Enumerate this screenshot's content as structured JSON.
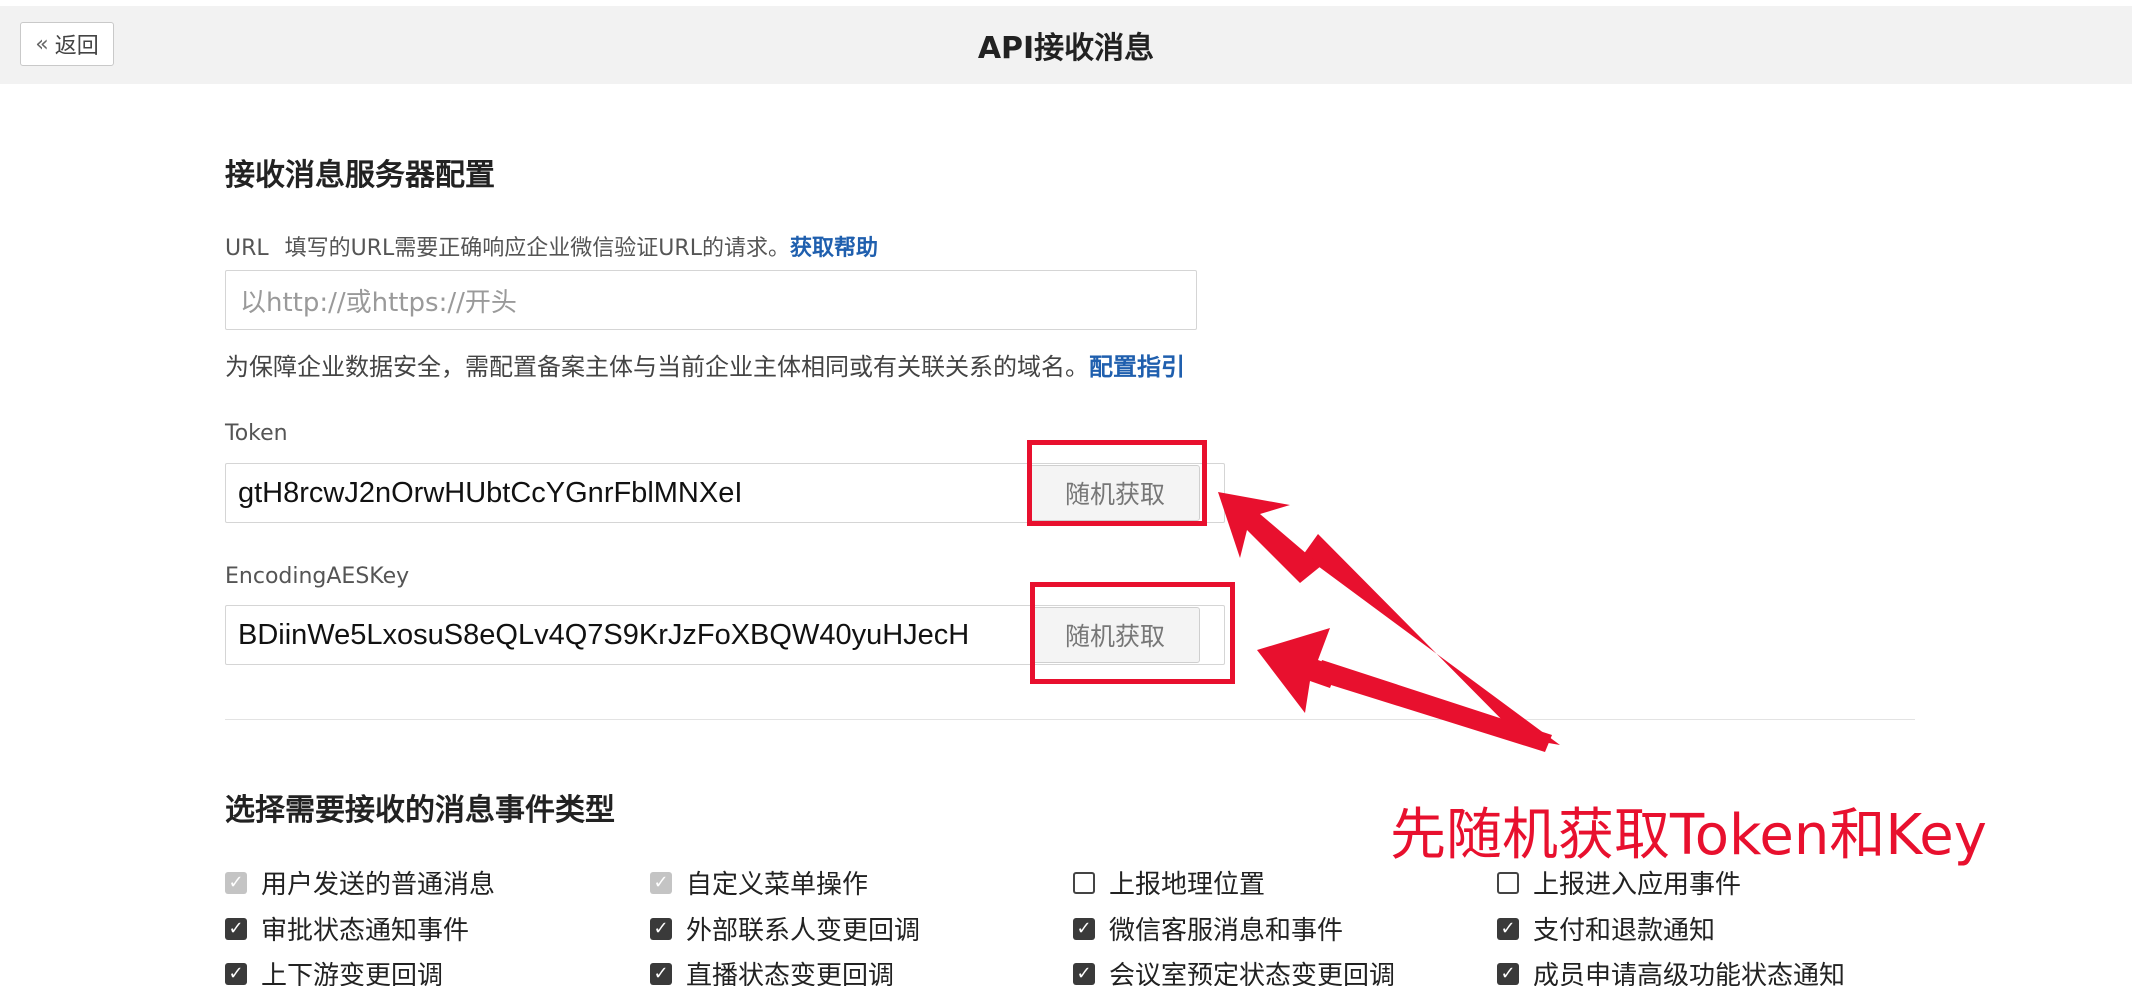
{
  "header": {
    "back_icon": "double-chevron-left-icon",
    "back_label": "返回",
    "title": "API接收消息"
  },
  "server_config": {
    "section_title": "接收消息服务器配置",
    "url": {
      "label": "URL",
      "hint": "填写的URL需要正确响应企业微信验证URL的请求。",
      "help_link": "获取帮助",
      "placeholder": "以http://或https://开头",
      "value": ""
    },
    "note": "为保障企业数据安全，需配置备案主体与当前企业主体相同或有关联关系的域名。",
    "note_link": "配置指引",
    "token": {
      "label": "Token",
      "value": "gtH8rcwJ2nOrwHUbtCcYGnrFblMNXeI",
      "button_label": "随机获取"
    },
    "aes_key": {
      "label": "EncodingAESKey",
      "value": "BDiinWe5LxosuS8eQLv4Q7S9KrJzFoXBQW40yuHJecH",
      "button_label": "随机获取"
    }
  },
  "events": {
    "section_title": "选择需要接收的消息事件类型",
    "rows": [
      [
        {
          "label": "用户发送的普通消息",
          "state": "disabled-checked"
        },
        {
          "label": "自定义菜单操作",
          "state": "disabled-checked"
        },
        {
          "label": "上报地理位置",
          "state": "unchecked"
        },
        {
          "label": "上报进入应用事件",
          "state": "unchecked"
        }
      ],
      [
        {
          "label": "审批状态通知事件",
          "state": "checked"
        },
        {
          "label": "外部联系人变更回调",
          "state": "checked"
        },
        {
          "label": "微信客服消息和事件",
          "state": "checked"
        },
        {
          "label": "支付和退款通知",
          "state": "checked"
        }
      ],
      [
        {
          "label": "上下游变更回调",
          "state": "checked"
        },
        {
          "label": "直播状态变更回调",
          "state": "checked"
        },
        {
          "label": "会议室预定状态变更回调",
          "state": "checked"
        },
        {
          "label": "成员申请高级功能状态通知",
          "state": "checked"
        }
      ]
    ]
  },
  "annotation": {
    "text": "先随机获取Token和Key",
    "color": "#e8102e"
  },
  "colors": {
    "link": "#1f5fae",
    "header_bg": "#f2f2f2",
    "checkbox_checked": "#3a3a3a",
    "checkbox_disabled": "#c4c4c4"
  }
}
